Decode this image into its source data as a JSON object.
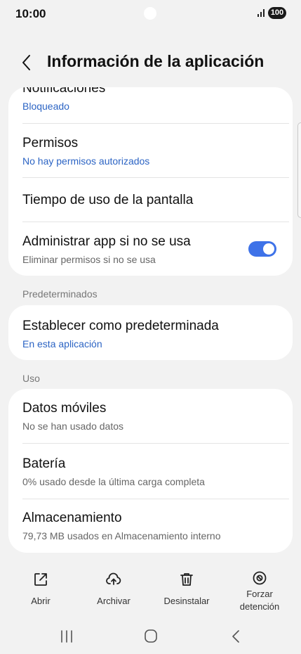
{
  "status_bar": {
    "time": "10:00",
    "battery": "100",
    "icons": [
      "signal-icon",
      "battery-icon"
    ]
  },
  "header": {
    "title": "Información de la aplicación",
    "back_icon": "chevron-left-icon"
  },
  "card_1": {
    "notifications": {
      "title": "Notificaciones",
      "subtitle": "Bloqueado"
    },
    "permissions": {
      "title": "Permisos",
      "subtitle": "No hay permisos autorizados"
    },
    "screen_time": {
      "title": "Tiempo de uso de la pantalla"
    },
    "manage_unused": {
      "title": "Administrar app si no se usa",
      "subtitle": "Eliminar permisos si no se usa",
      "enabled": true
    }
  },
  "defaults_section": {
    "label": "Predeterminados",
    "set_default": {
      "title": "Establecer como predeterminada",
      "subtitle": "En esta aplicación"
    }
  },
  "usage_section": {
    "label": "Uso",
    "mobile_data": {
      "title": "Datos móviles",
      "subtitle": "No se han usado datos"
    },
    "battery": {
      "title": "Batería",
      "subtitle": "0% usado desde la última carga completa"
    },
    "storage": {
      "title": "Almacenamiento",
      "subtitle": "79,73 MB usados en Almacenamiento interno"
    }
  },
  "actions": {
    "open": {
      "label": "Abrir",
      "icon": "open-external-icon"
    },
    "archive": {
      "label": "Archivar",
      "icon": "cloud-upload-icon"
    },
    "uninstall": {
      "label": "Desinstalar",
      "icon": "trash-icon"
    },
    "force_stop": {
      "label_line1": "Forzar",
      "label_line2": "detención",
      "icon": "block-icon"
    }
  },
  "colors": {
    "accent": "#3e72e8",
    "link": "#2c64c4",
    "background": "#f2f2f2",
    "card": "#ffffff"
  }
}
